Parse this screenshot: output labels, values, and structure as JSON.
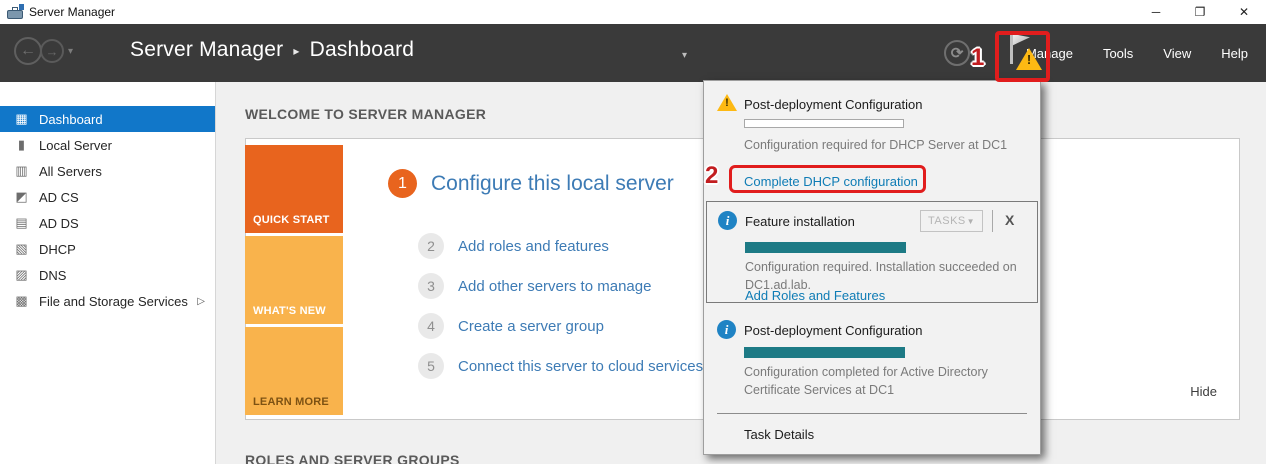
{
  "window": {
    "title": "Server Manager",
    "minimize_glyph": "─",
    "restore_glyph": "❐",
    "close_glyph": "✕"
  },
  "header": {
    "breadcrumb": {
      "root": "Server Manager",
      "separator": "▸",
      "current": "Dashboard"
    },
    "back_glyph": "←",
    "forward_glyph": "→",
    "caret_glyph": "▾",
    "refresh_glyph": "⟳",
    "menu": [
      {
        "label": "Manage"
      },
      {
        "label": "Tools"
      },
      {
        "label": "View"
      },
      {
        "label": "Help"
      }
    ]
  },
  "sidebar": {
    "items": [
      {
        "label": "Dashboard",
        "icon": "dashboard-icon",
        "glyph": "▦",
        "selected": true
      },
      {
        "label": "Local Server",
        "icon": "local-server-icon",
        "glyph": "▮",
        "selected": false
      },
      {
        "label": "All Servers",
        "icon": "all-servers-icon",
        "glyph": "▥",
        "selected": false
      },
      {
        "label": "AD CS",
        "icon": "ad-cs-icon",
        "glyph": "◩",
        "selected": false
      },
      {
        "label": "AD DS",
        "icon": "ad-ds-icon",
        "glyph": "▤",
        "selected": false
      },
      {
        "label": "DHCP",
        "icon": "dhcp-icon",
        "glyph": "▧",
        "selected": false
      },
      {
        "label": "DNS",
        "icon": "dns-icon",
        "glyph": "▨",
        "selected": false
      },
      {
        "label": "File and Storage Services",
        "icon": "file-storage-icon",
        "glyph": "▩",
        "selected": false,
        "expand_glyph": "▷"
      }
    ]
  },
  "main": {
    "welcome_title": "WELCOME TO SERVER MANAGER",
    "tiles": [
      {
        "label": "QUICK START"
      },
      {
        "label": "WHAT'S NEW"
      },
      {
        "label": "LEARN MORE"
      }
    ],
    "steps": [
      {
        "num": "1",
        "label": "Configure this local server"
      },
      {
        "num": "2",
        "label": "Add roles and features"
      },
      {
        "num": "3",
        "label": "Add other servers to manage"
      },
      {
        "num": "4",
        "label": "Create a server group"
      },
      {
        "num": "5",
        "label": "Connect this server to cloud services"
      }
    ],
    "hide_label": "Hide",
    "roles_title": "ROLES AND SERVER GROUPS"
  },
  "notifications": {
    "items": [
      {
        "icon": "warning-icon",
        "title": "Post-deployment Configuration",
        "progress": 0,
        "message": "Configuration required for DHCP Server at DC1",
        "action": "Complete DHCP configuration"
      },
      {
        "icon": "info-icon",
        "info_glyph": "i",
        "title": "Feature installation",
        "tasks_label": "TASKS",
        "tasks_caret": "▼",
        "close_glyph": "X",
        "progress": 100,
        "message": "Configuration required. Installation succeeded on DC1.ad.lab.",
        "action": "Add Roles and Features"
      },
      {
        "icon": "info-icon",
        "info_glyph": "i",
        "title": "Post-deployment Configuration",
        "progress": 100,
        "message": "Configuration completed for Active Directory Certificate Services at DC1"
      }
    ],
    "footer_link": "Task Details"
  },
  "annotations": {
    "step1": "1",
    "step2": "2"
  },
  "colors": {
    "accent_blue": "#1177c9",
    "link_blue": "#0f7cb5",
    "orange_strong": "#e8641e",
    "orange_light": "#f9b34c",
    "teal_progress": "#1d7a85",
    "warning_yellow": "#fdb913",
    "annotation_red": "#e11d1d",
    "header_dark": "#3a3a3a"
  }
}
